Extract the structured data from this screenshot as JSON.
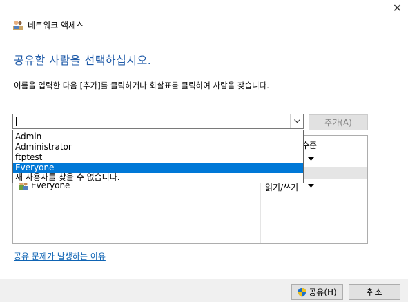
{
  "window": {
    "close_glyph": "✕",
    "title": "네트워크 액세스"
  },
  "main": {
    "heading": "공유할 사람을 선택하십시오.",
    "instruction": "이름을 입력한 다음 [추가]를 클릭하거나 화살표를 클릭하여 사람을 찾습니다.",
    "combo_value": "",
    "add_button": "추가(A)",
    "dropdown_items": [
      "Admin",
      "Administrator",
      "ftptest",
      "Everyone",
      "새 사용자를 찾을 수 없습니다."
    ],
    "dropdown_selected": "Everyone",
    "list": {
      "col_level": "수준",
      "rows": [
        {
          "name": "Everyone",
          "permission": "읽기/쓰기"
        }
      ]
    },
    "help_link": "공유 문제가 발생하는 이유"
  },
  "footer": {
    "share_button": "공유(H)",
    "cancel_button": "취소"
  },
  "colors": {
    "accent": "#1e5aa8",
    "selection": "#0078d7",
    "link": "#0f64b4"
  },
  "icons": [
    "network-users-icon",
    "close-icon",
    "chevron-down-icon",
    "group-users-icon",
    "uac-shield-icon"
  ]
}
